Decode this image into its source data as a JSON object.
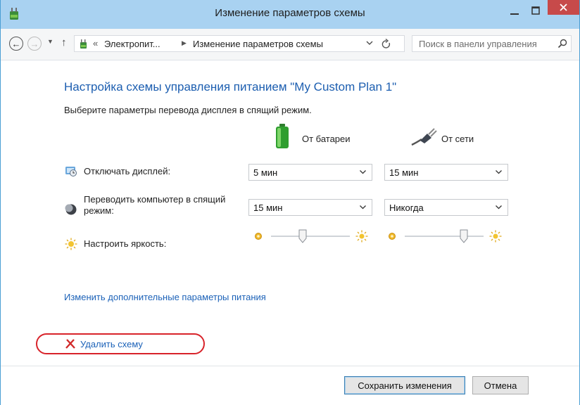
{
  "window": {
    "title": "Изменение параметров схемы",
    "accent_color": "#a9d2f1",
    "close_color": "#c74a4a"
  },
  "navigation": {
    "back_icon": "back-arrow-icon",
    "forward_icon": "forward-arrow-icon",
    "recent_icon": "chevron-down-icon",
    "up_icon": "up-arrow-icon",
    "address": {
      "overflow": "«",
      "crumb_1": "Электропит...",
      "separator": "▶",
      "crumb_2": "Изменение параметров схемы"
    },
    "search_placeholder": "Поиск в панели управления"
  },
  "main": {
    "heading": "Настройка схемы управления питанием \"My Custom Plan 1\"",
    "subheading": "Выберите параметры перевода дисплея в спящий режим.",
    "columns": {
      "battery": "От батареи",
      "plugged": "От сети"
    },
    "rows": {
      "display": {
        "label": "Отключать дисплей:",
        "battery_value": "5 мин",
        "plugged_value": "15 мин"
      },
      "sleep": {
        "label_line1": "Переводить компьютер в спящий",
        "label_line2": "режим:",
        "battery_value": "15 мин",
        "plugged_value": "Никогда"
      },
      "brightness": {
        "label": "Настроить яркость:",
        "battery_level": 0.4,
        "plugged_level": 0.75
      }
    },
    "advanced_link": "Изменить дополнительные параметры питания",
    "delete_link": "Удалить схему",
    "highlight_color": "#d8232a"
  },
  "footer": {
    "save_label": "Сохранить изменения",
    "cancel_label": "Отмена"
  }
}
